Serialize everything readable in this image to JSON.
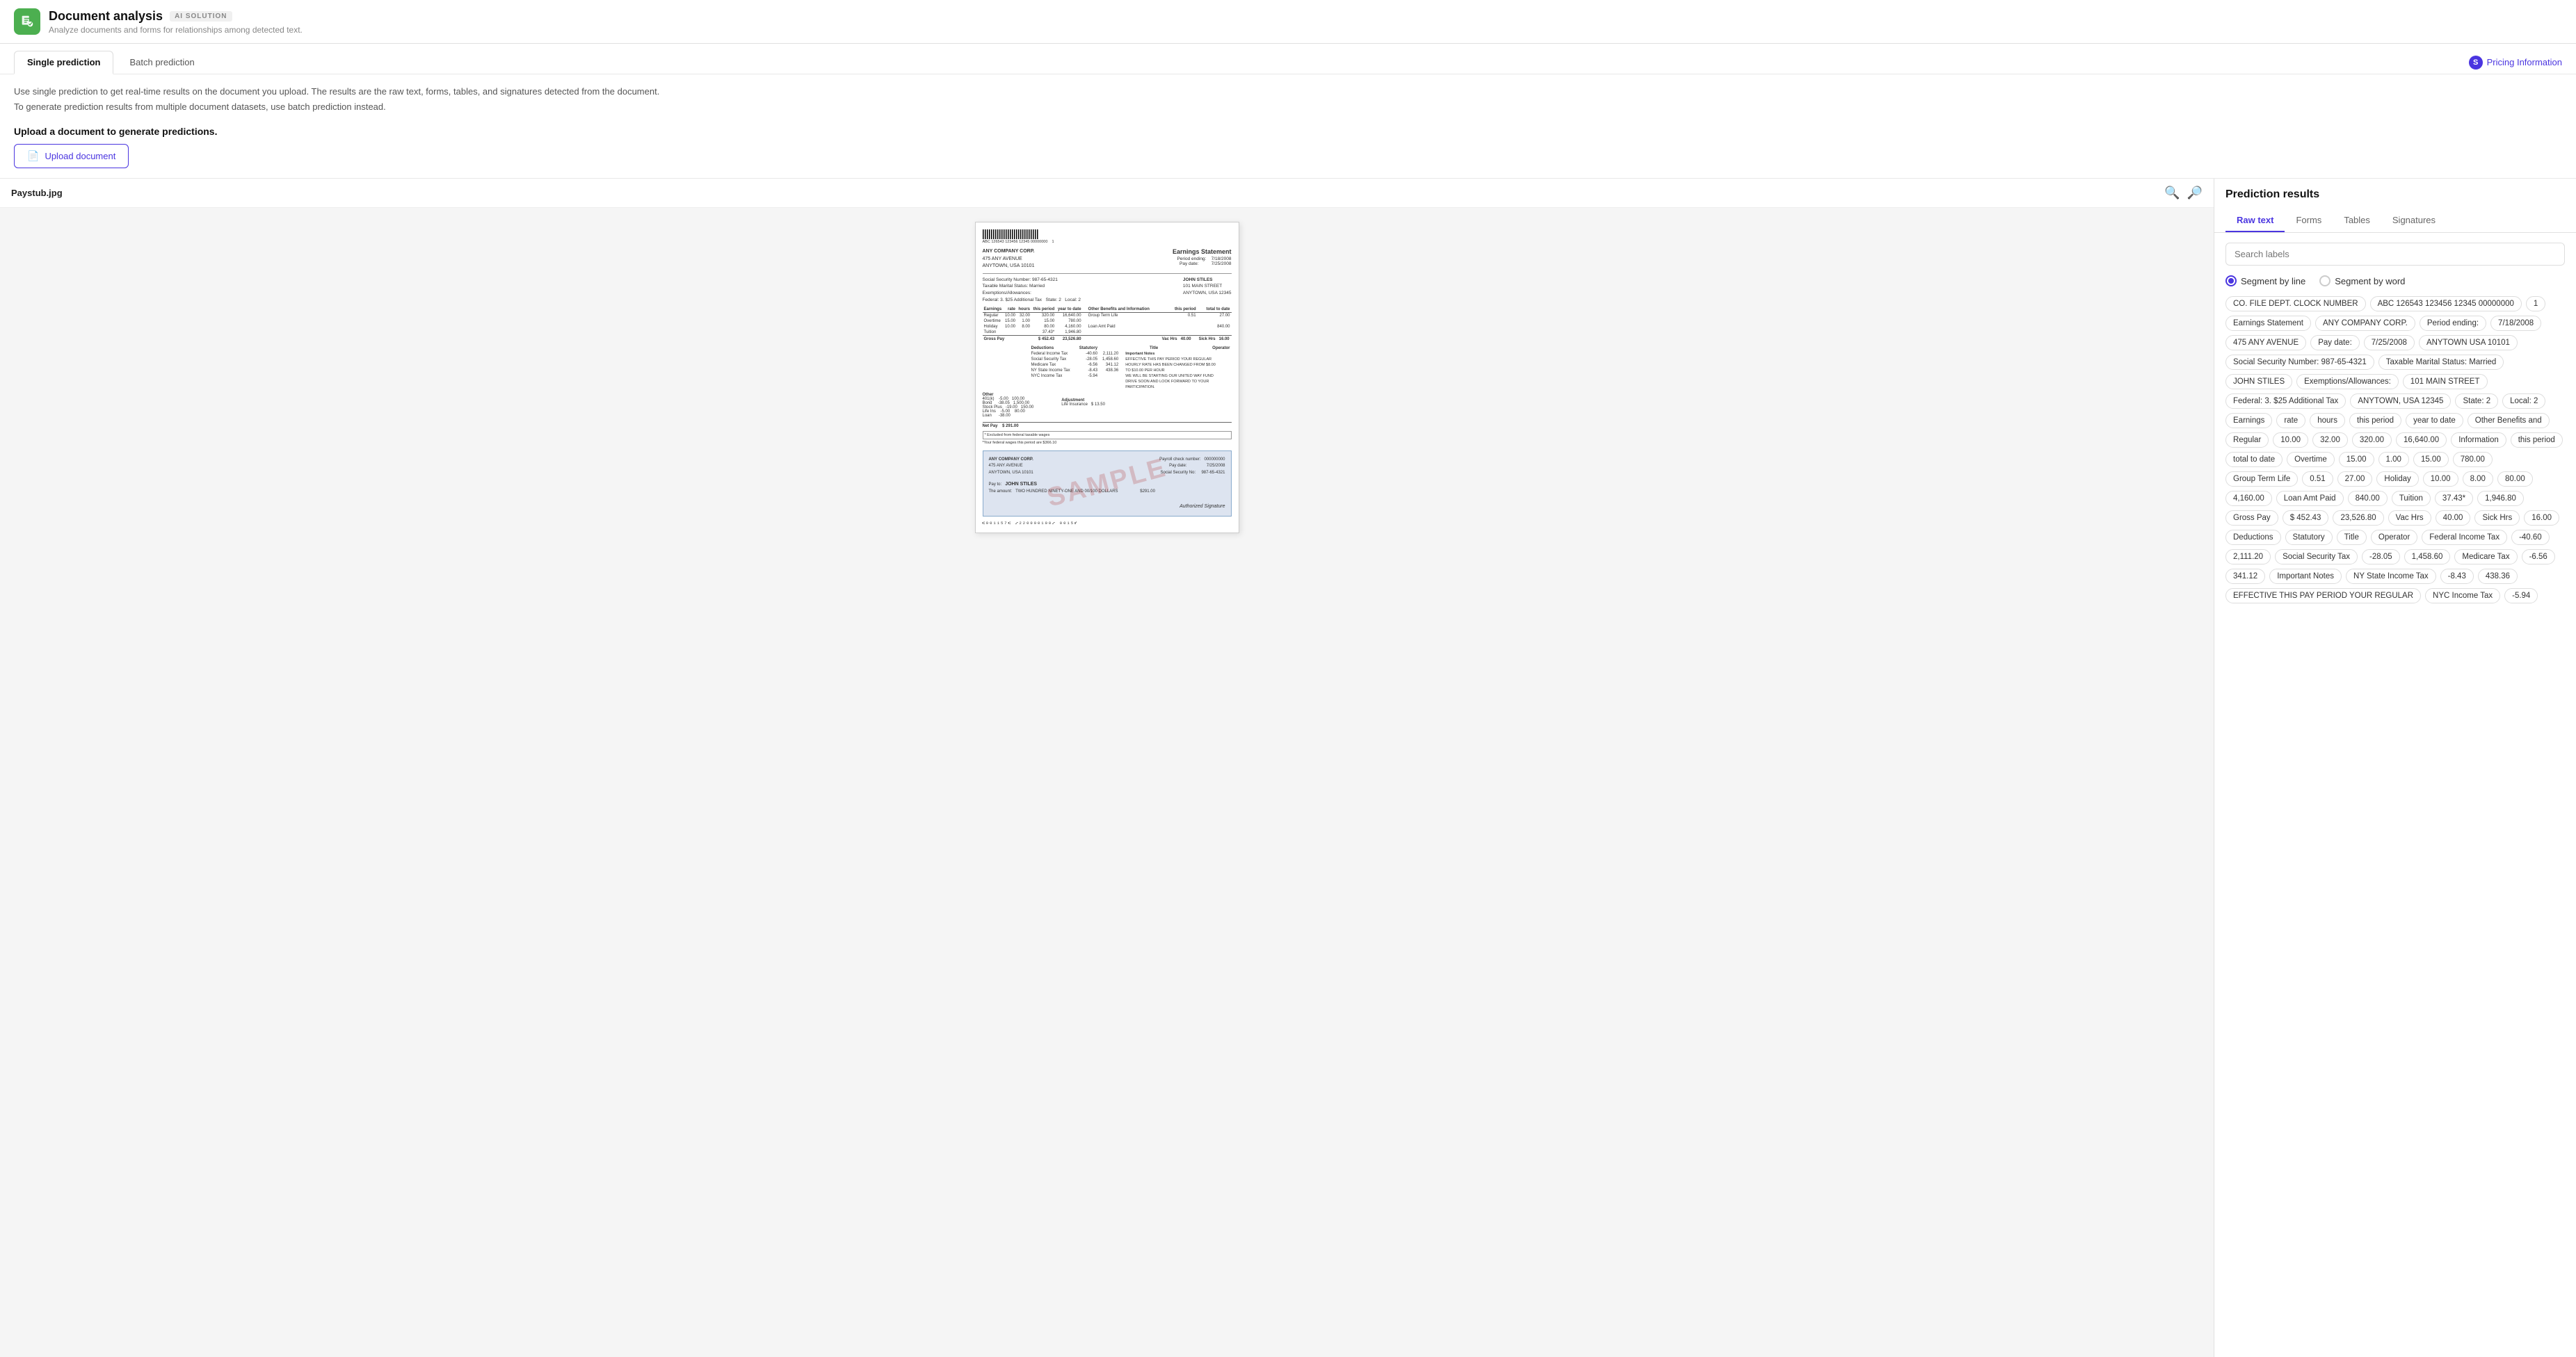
{
  "header": {
    "title": "Document analysis",
    "badge": "AI SOLUTION",
    "subtitle": "Analyze documents and forms for relationships among detected text.",
    "icon_color": "#4caf50"
  },
  "tabs": {
    "single_label": "Single prediction",
    "batch_label": "Batch prediction",
    "pricing_label": "Pricing Information"
  },
  "description": {
    "line1": "Use single prediction to get real-time results on the document you upload. The results are the raw text, forms, tables, and signatures detected from the document.",
    "line2": "To generate prediction results from multiple document datasets, use batch prediction instead."
  },
  "upload": {
    "label": "Upload a document to generate predictions.",
    "button": "Upload document"
  },
  "document": {
    "filename": "Paystub.jpg"
  },
  "results": {
    "title": "Prediction results",
    "tabs": [
      "Raw text",
      "Forms",
      "Tables",
      "Signatures"
    ],
    "search_placeholder": "Search labels",
    "segment_options": [
      "Segment by line",
      "Segment by word"
    ],
    "tags": [
      "CO. FILE DEPT. CLOCK NUMBER",
      "ABC 126543 123456 12345 00000000",
      "1",
      "Earnings Statement",
      "ANY COMPANY CORP.",
      "Period ending:",
      "7/18/2008",
      "475 ANY AVENUE",
      "Pay date:",
      "7/25/2008",
      "ANYTOWN USA 10101",
      "Social Security Number: 987-65-4321",
      "Taxable Marital Status: Married",
      "JOHN STILES",
      "Exemptions/Allowances:",
      "101 MAIN STREET",
      "Federal: 3. $25 Additional Tax",
      "ANYTOWN, USA 12345",
      "State: 2",
      "Local: 2",
      "Earnings",
      "rate",
      "hours",
      "this period",
      "year to date",
      "Other Benefits and",
      "Regular",
      "10.00",
      "32.00",
      "320.00",
      "16,640.00",
      "Information",
      "this period",
      "total to date",
      "Overtime",
      "15.00",
      "1.00",
      "15.00",
      "780.00",
      "Group Term Life",
      "0.51",
      "27.00",
      "Holiday",
      "10.00",
      "8.00",
      "80.00",
      "4,160.00",
      "Loan Amt Paid",
      "840.00",
      "Tuition",
      "37.43*",
      "1,946.80",
      "Gross Pay",
      "$ 452.43",
      "23,526.80",
      "Vac Hrs",
      "40.00",
      "Sick Hrs",
      "16.00",
      "Deductions",
      "Statutory",
      "Title",
      "Operator",
      "Federal Income Tax",
      "-40.60",
      "2,111.20",
      "Social Security Tax",
      "-28.05",
      "1,458.60",
      "Medicare Tax",
      "-6.56",
      "341.12",
      "Important Notes",
      "NY State Income Tax",
      "-8.43",
      "438.36",
      "EFFECTIVE THIS PAY PERIOD YOUR REGULAR",
      "NYC Income Tax",
      "-5.94"
    ]
  }
}
